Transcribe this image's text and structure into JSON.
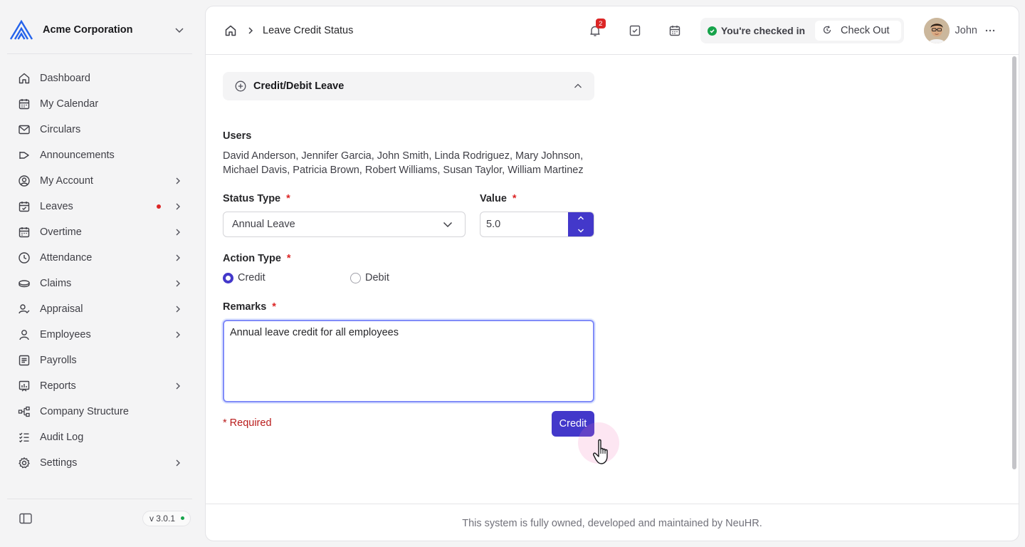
{
  "org": {
    "name": "Acme Corporation"
  },
  "sidebar": {
    "items": [
      {
        "label": "Dashboard",
        "icon": "home-icon",
        "chevron": false
      },
      {
        "label": "My Calendar",
        "icon": "calendar-icon",
        "chevron": false
      },
      {
        "label": "Circulars",
        "icon": "mail-icon",
        "chevron": false
      },
      {
        "label": "Announcements",
        "icon": "megaphone-icon",
        "chevron": false
      },
      {
        "label": "My Account",
        "icon": "user-circle-icon",
        "chevron": true
      },
      {
        "label": "Leaves",
        "icon": "calendar-check-icon",
        "chevron": true,
        "dot": true
      },
      {
        "label": "Overtime",
        "icon": "calendar-clock-icon",
        "chevron": true
      },
      {
        "label": "Attendance",
        "icon": "clock-icon",
        "chevron": true
      },
      {
        "label": "Claims",
        "icon": "coins-icon",
        "chevron": true
      },
      {
        "label": "Appraisal",
        "icon": "user-check-icon",
        "chevron": true
      },
      {
        "label": "Employees",
        "icon": "user-icon",
        "chevron": true
      },
      {
        "label": "Payrolls",
        "icon": "receipt-icon",
        "chevron": false
      },
      {
        "label": "Reports",
        "icon": "chart-icon",
        "chevron": true
      },
      {
        "label": "Company Structure",
        "icon": "hierarchy-icon",
        "chevron": false
      },
      {
        "label": "Audit Log",
        "icon": "list-check-icon",
        "chevron": false
      },
      {
        "label": "Settings",
        "icon": "gear-icon",
        "chevron": true
      }
    ],
    "version": "v 3.0.1"
  },
  "topbar": {
    "breadcrumb": "Leave Credit Status",
    "notification_count": "2",
    "checked_in_text": "You're checked in",
    "checkout_label": "Check Out",
    "user_name": "John"
  },
  "form": {
    "section_title": "Credit/Debit Leave",
    "users_label": "Users",
    "users_value": "David Anderson, Jennifer Garcia, John Smith, Linda Rodriguez, Mary Johnson, Michael Davis, Patricia Brown, Robert Williams, Susan Taylor, William Martinez",
    "status_type_label": "Status Type",
    "status_type_value": "Annual Leave",
    "value_label": "Value",
    "value_value": "5.0",
    "action_type_label": "Action Type",
    "action_credit": "Credit",
    "action_debit": "Debit",
    "remarks_label": "Remarks",
    "remarks_value": "Annual leave credit for all employees",
    "required_note": "* Required",
    "submit_label": "Credit",
    "required_mark": "*"
  },
  "footer": {
    "text": "This system is fully owned, developed and maintained by NeuHR."
  },
  "colors": {
    "accent": "#4338ca",
    "success": "#16a34a",
    "danger": "#dc2626"
  }
}
